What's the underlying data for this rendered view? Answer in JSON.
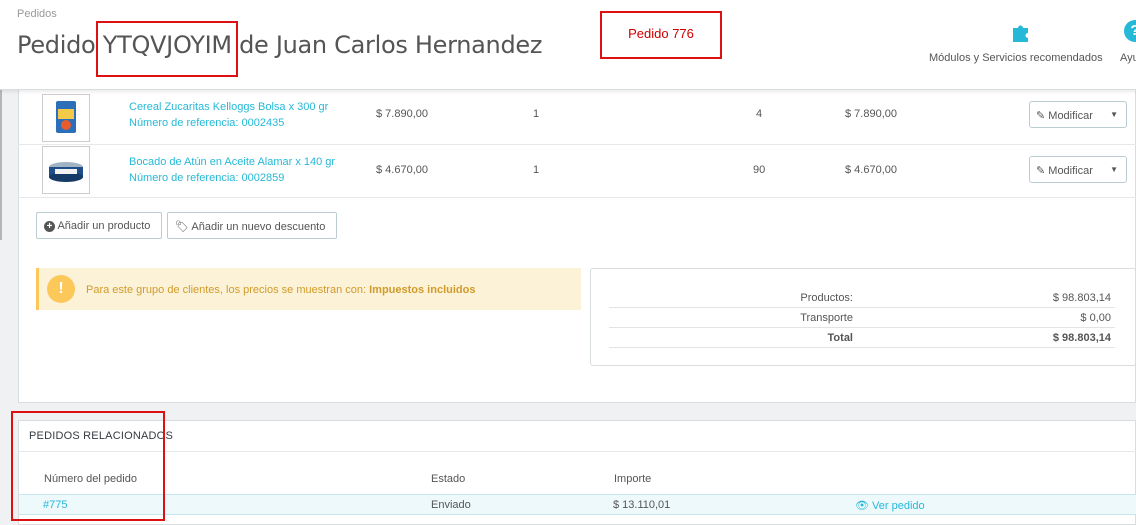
{
  "header": {
    "breadcrumb": "Pedidos",
    "title_prefix": "Pedido ",
    "title_code": "YTQVJOYIM",
    "title_suffix": " de Juan Carlos Hernandez",
    "annotation": "Pedido 776",
    "modules_label": "Módulos y Servicios recomendados",
    "help_label": "Ayu",
    "help_glyph": "?",
    "accent_color": "#25b9d7"
  },
  "products": [
    {
      "name": "Cereal Zucaritas Kelloggs Bolsa x 300 gr",
      "reference": "Número de referencia: 0002435",
      "price": "$ 7.890,00",
      "quantity": "1",
      "stock": "4",
      "total": "$ 7.890,00",
      "action": "Modificar",
      "icon": "cereal-box-image"
    },
    {
      "name": "Bocado de Atún en Aceite Alamar x 140 gr",
      "reference": "Número de referencia: 0002859",
      "price": "$ 4.670,00",
      "quantity": "1",
      "stock": "90",
      "total": "$ 4.670,00",
      "action": "Modificar",
      "icon": "tuna-can-image"
    }
  ],
  "actions": {
    "add_product": "Añadir un producto",
    "add_discount": "Añadir un nuevo descuento"
  },
  "alert": {
    "text": "Para este grupo de clientes, los precios se muestran con:",
    "emphasis": "Impuestos incluidos",
    "glyph": "!"
  },
  "totals": [
    {
      "label": "Productos:",
      "value": "$ 98.803,14"
    },
    {
      "label": "Transporte",
      "value": "$ 0,00"
    },
    {
      "label": "Total",
      "value": "$ 98.803,14"
    }
  ],
  "related": {
    "title": "PEDIDOS RELACIONADOS",
    "columns": [
      "Número del pedido",
      "Estado",
      "Importe"
    ],
    "rows": [
      {
        "order": "#775",
        "status": "Enviado",
        "amount": "$ 13.110,01",
        "view": "Ver pedido"
      }
    ]
  }
}
